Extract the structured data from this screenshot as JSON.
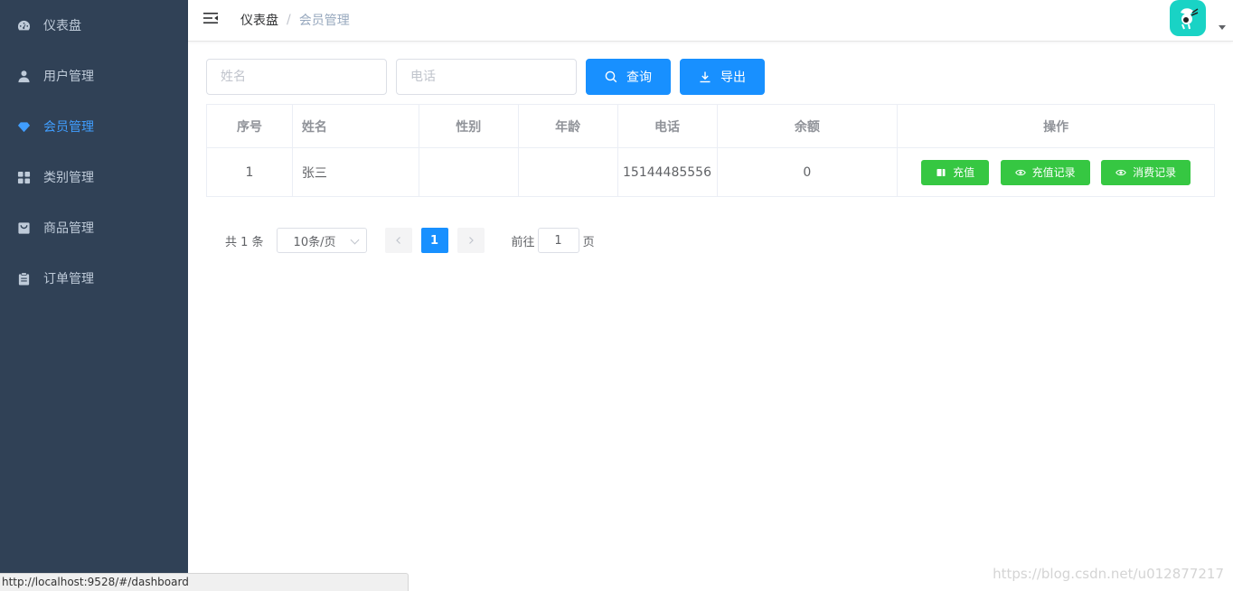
{
  "sidebar": {
    "items": [
      {
        "label": "仪表盘",
        "icon": "dashboard-icon"
      },
      {
        "label": "用户管理",
        "icon": "user-icon"
      },
      {
        "label": "会员管理",
        "icon": "diamond-icon",
        "active": true
      },
      {
        "label": "类别管理",
        "icon": "grid-icon"
      },
      {
        "label": "商品管理",
        "icon": "shopping-icon"
      },
      {
        "label": "订单管理",
        "icon": "clipboard-icon"
      }
    ],
    "bg_color": "#304156",
    "text_color": "#bfcbd9",
    "active_color": "#409eff"
  },
  "navbar": {
    "breadcrumb": [
      "仪表盘",
      "会员管理"
    ],
    "breadcrumb_separator": "/",
    "avatar_color": "#19d3c5"
  },
  "filter": {
    "name_placeholder": "姓名",
    "phone_placeholder": "电话",
    "search_label": "查询",
    "export_label": "导出",
    "primary_color": "#1890ff"
  },
  "table": {
    "columns": [
      "序号",
      "姓名",
      "性别",
      "年龄",
      "电话",
      "余额",
      "操作"
    ],
    "rows": [
      {
        "index": "1",
        "name": "张三",
        "gender": "",
        "age": "",
        "phone": "15144485556",
        "balance": "0"
      }
    ],
    "actions": [
      "充值",
      "充值记录",
      "消费记录"
    ],
    "action_color": "#36c742"
  },
  "pagination": {
    "total": "共 1 条",
    "page_size": "10条/页",
    "current_page": "1",
    "goto_prefix": "前往",
    "goto_value": "1",
    "goto_suffix": "页"
  },
  "statusbar": {
    "url": "http://localhost:9528/#/dashboard"
  },
  "watermark": "https://blog.csdn.net/u012877217"
}
